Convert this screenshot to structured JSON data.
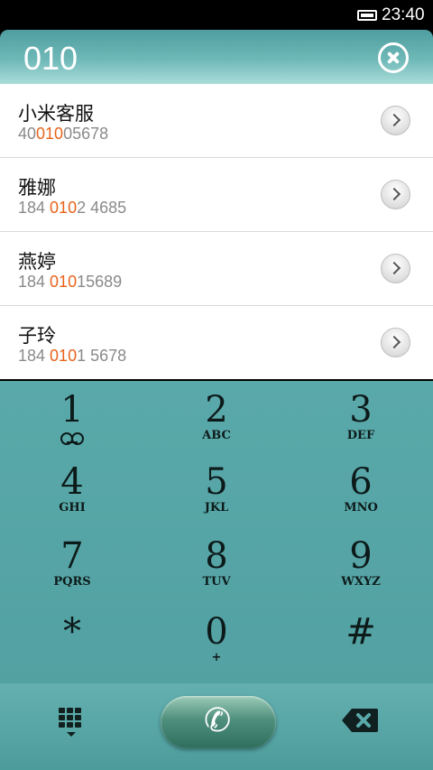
{
  "status_bar": {
    "time": "23:40"
  },
  "search": {
    "query": "010"
  },
  "results": [
    {
      "name": "小米客服",
      "number_pre": "40",
      "number_match": "010",
      "number_post": "05678"
    },
    {
      "name": "雅娜",
      "number_pre": "184 ",
      "number_match": "010",
      "number_post": "2 4685"
    },
    {
      "name": "燕婷",
      "number_pre": "184 ",
      "number_match": "010",
      "number_post": "15689"
    },
    {
      "name": "子玲",
      "number_pre": "184 ",
      "number_match": "010",
      "number_post": "1 5678"
    }
  ],
  "keypad": {
    "keys": [
      {
        "digit": "1",
        "letters": ""
      },
      {
        "digit": "2",
        "letters": "ABC"
      },
      {
        "digit": "3",
        "letters": "DEF"
      },
      {
        "digit": "4",
        "letters": "GHI"
      },
      {
        "digit": "5",
        "letters": "JKL"
      },
      {
        "digit": "6",
        "letters": "MNO"
      },
      {
        "digit": "7",
        "letters": "PQRS"
      },
      {
        "digit": "8",
        "letters": "TUV"
      },
      {
        "digit": "9",
        "letters": "WXYZ"
      },
      {
        "digit": "*",
        "letters": ""
      },
      {
        "digit": "0",
        "letters": "+"
      },
      {
        "digit": "#",
        "letters": ""
      }
    ]
  },
  "colors": {
    "accent": "#e8631c",
    "keypad_bg": "#5aa9aa",
    "call_button": "#3e7f6c"
  },
  "icons": {
    "clear": "close-circle-icon",
    "chevron": "chevron-right-icon",
    "dialpad": "dialpad-icon",
    "call": "phone-icon",
    "backspace": "backspace-icon",
    "battery": "battery-icon",
    "voicemail": "voicemail-icon"
  }
}
